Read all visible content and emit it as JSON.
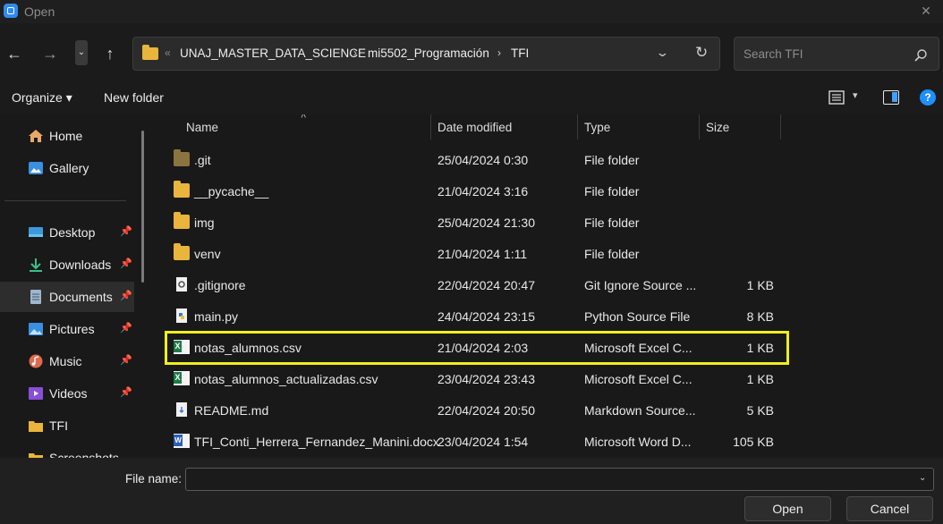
{
  "window": {
    "title": "Open",
    "close_glyph": "✕"
  },
  "nav": {
    "back_glyph": "←",
    "forward_glyph": "→",
    "up_glyph": "↑",
    "recent_glyph": "⌄"
  },
  "address": {
    "overflow_glyph": "«",
    "crumbs": [
      "UNAJ_MASTER_DATA_SCIENCE",
      "mi5502_Programación",
      "TFI"
    ],
    "separator": "›",
    "dropdown_glyph": "⌄",
    "refresh_glyph": "↻"
  },
  "search": {
    "placeholder": "Search TFI"
  },
  "commandbar": {
    "organize_label": "Organize ▾",
    "new_folder_label": "New folder",
    "view_chevron": "▾",
    "help_label": "?"
  },
  "sidebar": {
    "items": [
      {
        "label": "Home",
        "icon": "home-icon",
        "pinned": false
      },
      {
        "label": "Gallery",
        "icon": "gallery-icon",
        "pinned": false
      },
      {
        "label": "Desktop",
        "icon": "desktop-icon",
        "pinned": true
      },
      {
        "label": "Downloads",
        "icon": "download-icon",
        "pinned": true
      },
      {
        "label": "Documents",
        "icon": "documents-icon",
        "pinned": true,
        "selected": true
      },
      {
        "label": "Pictures",
        "icon": "pictures-icon",
        "pinned": true
      },
      {
        "label": "Music",
        "icon": "music-icon",
        "pinned": true
      },
      {
        "label": "Videos",
        "icon": "videos-icon",
        "pinned": true
      },
      {
        "label": "TFI",
        "icon": "folder-icon",
        "pinned": false
      },
      {
        "label": "Screenshots",
        "icon": "folder-icon",
        "pinned": false
      }
    ],
    "pin_glyph": "📌"
  },
  "columns": {
    "name": "Name",
    "date": "Date modified",
    "type": "Type",
    "size": "Size",
    "sort_glyph": "˄"
  },
  "files": [
    {
      "name": ".git",
      "date": "25/04/2024 0:30",
      "type": "File folder",
      "size": "",
      "icon": "folder-dark-icon"
    },
    {
      "name": "__pycache__",
      "date": "21/04/2024 3:16",
      "type": "File folder",
      "size": "",
      "icon": "folder-icon"
    },
    {
      "name": "img",
      "date": "25/04/2024 21:30",
      "type": "File folder",
      "size": "",
      "icon": "folder-icon"
    },
    {
      "name": "venv",
      "date": "21/04/2024 1:11",
      "type": "File folder",
      "size": "",
      "icon": "folder-icon"
    },
    {
      "name": ".gitignore",
      "date": "22/04/2024 20:47",
      "type": "Git Ignore Source ...",
      "size": "1 KB",
      "icon": "settings-file-icon"
    },
    {
      "name": "main.py",
      "date": "24/04/2024 23:15",
      "type": "Python Source File",
      "size": "8 KB",
      "icon": "python-file-icon"
    },
    {
      "name": "notas_alumnos.csv",
      "date": "21/04/2024 2:03",
      "type": "Microsoft Excel C...",
      "size": "1 KB",
      "icon": "excel-file-icon",
      "highlighted": true
    },
    {
      "name": "notas_alumnos_actualizadas.csv",
      "date": "23/04/2024 23:43",
      "type": "Microsoft Excel C...",
      "size": "1 KB",
      "icon": "excel-file-icon"
    },
    {
      "name": "README.md",
      "date": "22/04/2024 20:50",
      "type": "Markdown Source...",
      "size": "5 KB",
      "icon": "markdown-file-icon"
    },
    {
      "name": "TFI_Conti_Herrera_Fernandez_Manini.docx",
      "date": "23/04/2024 1:54",
      "type": "Microsoft Word D...",
      "size": "105 KB",
      "icon": "word-file-icon"
    }
  ],
  "bottom": {
    "file_name_label": "File name:",
    "file_name_value": "",
    "dropdown_glyph": "⌄",
    "open_label": "Open",
    "cancel_label": "Cancel"
  },
  "colors": {
    "accent": "#1f8fff",
    "highlight": "#f2ee1a",
    "folder": "#e9b53c"
  }
}
